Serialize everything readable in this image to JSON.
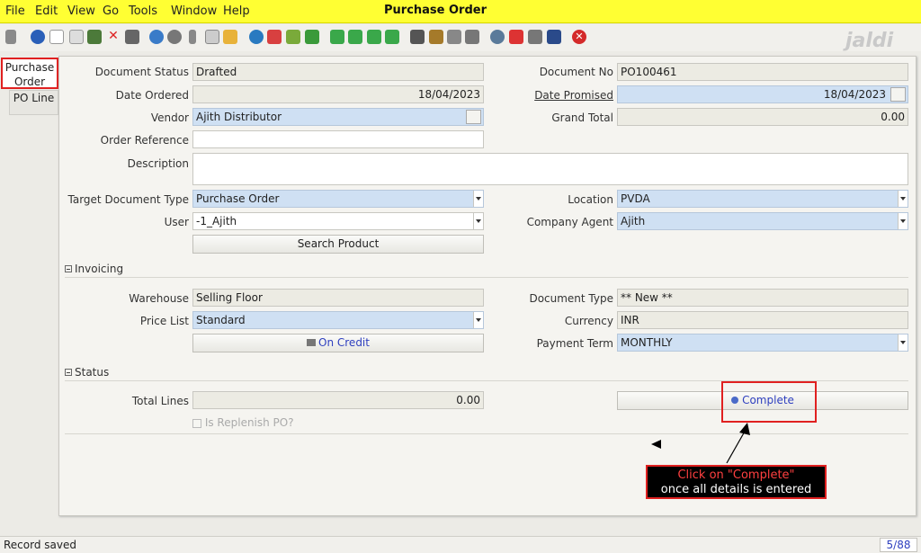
{
  "menu": {
    "items": [
      {
        "label": "File"
      },
      {
        "label": "Edit"
      },
      {
        "label": "View"
      },
      {
        "label": "Go"
      },
      {
        "label": "Tools"
      },
      {
        "label": "Window"
      },
      {
        "label": "Help"
      }
    ],
    "title": "Purchase Order"
  },
  "branding": {
    "logo_text": "jaldi"
  },
  "tabs": {
    "active": "Purchase Order",
    "inactive": "PO Line"
  },
  "form": {
    "document_status_label": "Document Status",
    "document_status_value": "Drafted",
    "document_no_label": "Document No",
    "document_no_value": "PO100461",
    "date_ordered_label": "Date Ordered",
    "date_ordered_value": "18/04/2023",
    "date_promised_label": "Date Promised",
    "date_promised_value": "18/04/2023",
    "vendor_label": "Vendor",
    "vendor_value": "Ajith Distributor",
    "grand_total_label": "Grand Total",
    "grand_total_value": "0.00",
    "order_reference_label": "Order Reference",
    "order_reference_value": "",
    "description_label": "Description",
    "description_value": "",
    "target_doc_type_label": "Target Document Type",
    "target_doc_type_value": "Purchase Order",
    "location_label": "Location",
    "location_value": "PVDA",
    "user_label": "User",
    "user_value": "-1_Ajith",
    "company_agent_label": "Company Agent",
    "company_agent_value": "Ajith",
    "search_product_label": "Search Product"
  },
  "invoicing": {
    "section_label": "Invoicing",
    "warehouse_label": "Warehouse",
    "warehouse_value": "Selling Floor",
    "document_type_label": "Document Type",
    "document_type_value": "** New **",
    "price_list_label": "Price List",
    "price_list_value": "Standard",
    "currency_label": "Currency",
    "currency_value": "INR",
    "on_credit_label": "On Credit",
    "payment_term_label": "Payment Term",
    "payment_term_value": "MONTHLY"
  },
  "status": {
    "section_label": "Status",
    "total_lines_label": "Total Lines",
    "total_lines_value": "0.00",
    "complete_label": "Complete",
    "replenish_label": "Is Replenish PO?"
  },
  "annotation": {
    "line1": "Click on \"Complete\"",
    "line2": "once all details is entered"
  },
  "statusbar": {
    "message": "Record saved",
    "record_count": "5/88"
  },
  "colors": {
    "menubar": "#ffff33",
    "mandatory_field": "#cfe0f3",
    "highlight": "#e02020"
  }
}
